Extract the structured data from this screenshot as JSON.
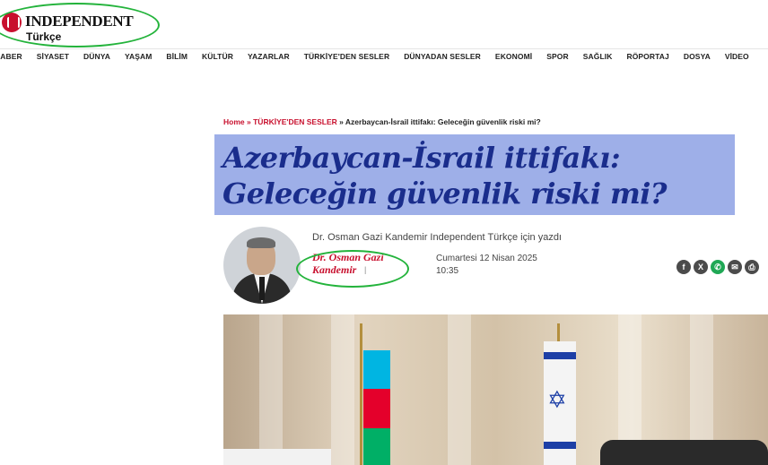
{
  "site": {
    "logo_title": "INDEPENDENT",
    "logo_sub": "Türkçe"
  },
  "nav": {
    "items": [
      "HABER",
      "SİYASET",
      "DÜNYA",
      "YAŞAM",
      "BİLİM",
      "KÜLTÜR",
      "YAZARLAR",
      "TÜRKİYE'DEN SESLER",
      "DÜNYADAN SESLER",
      "EKONOMİ",
      "SPOR",
      "SAĞLIK",
      "RÖPORTAJ",
      "DOSYA",
      "VİDEO"
    ]
  },
  "breadcrumb": {
    "home": "Home",
    "sep1": "»",
    "section": "TÜRKİYE'DEN SESLER",
    "sep2": "»",
    "current": "Azerbaycan-İsrail ittifakı: Geleceğin güvenlik riski mi?"
  },
  "article": {
    "title": "Azerbaycan-İsrail ittifakı: Geleceğin güvenlik riski mi?",
    "byline": "Dr. Osman Gazi Kandemir Independent Türkçe için yazdı",
    "author": "Dr. Osman Gazi Kandemir",
    "author_pipe": "|",
    "date": "Cumartesi 12 Nisan 2025",
    "time": "10:35"
  },
  "share": {
    "icons": [
      "facebook-icon",
      "x-icon",
      "whatsapp-icon",
      "email-icon",
      "print-icon"
    ],
    "glyphs": [
      "f",
      "X",
      "✆",
      "✉",
      "⎙"
    ]
  },
  "colors": {
    "accent_red": "#c8102e",
    "title_blue": "#1a2d8c",
    "title_highlight": "#9eafe8",
    "annotation_green": "#23b33b",
    "whatsapp_green": "#1fa855"
  }
}
